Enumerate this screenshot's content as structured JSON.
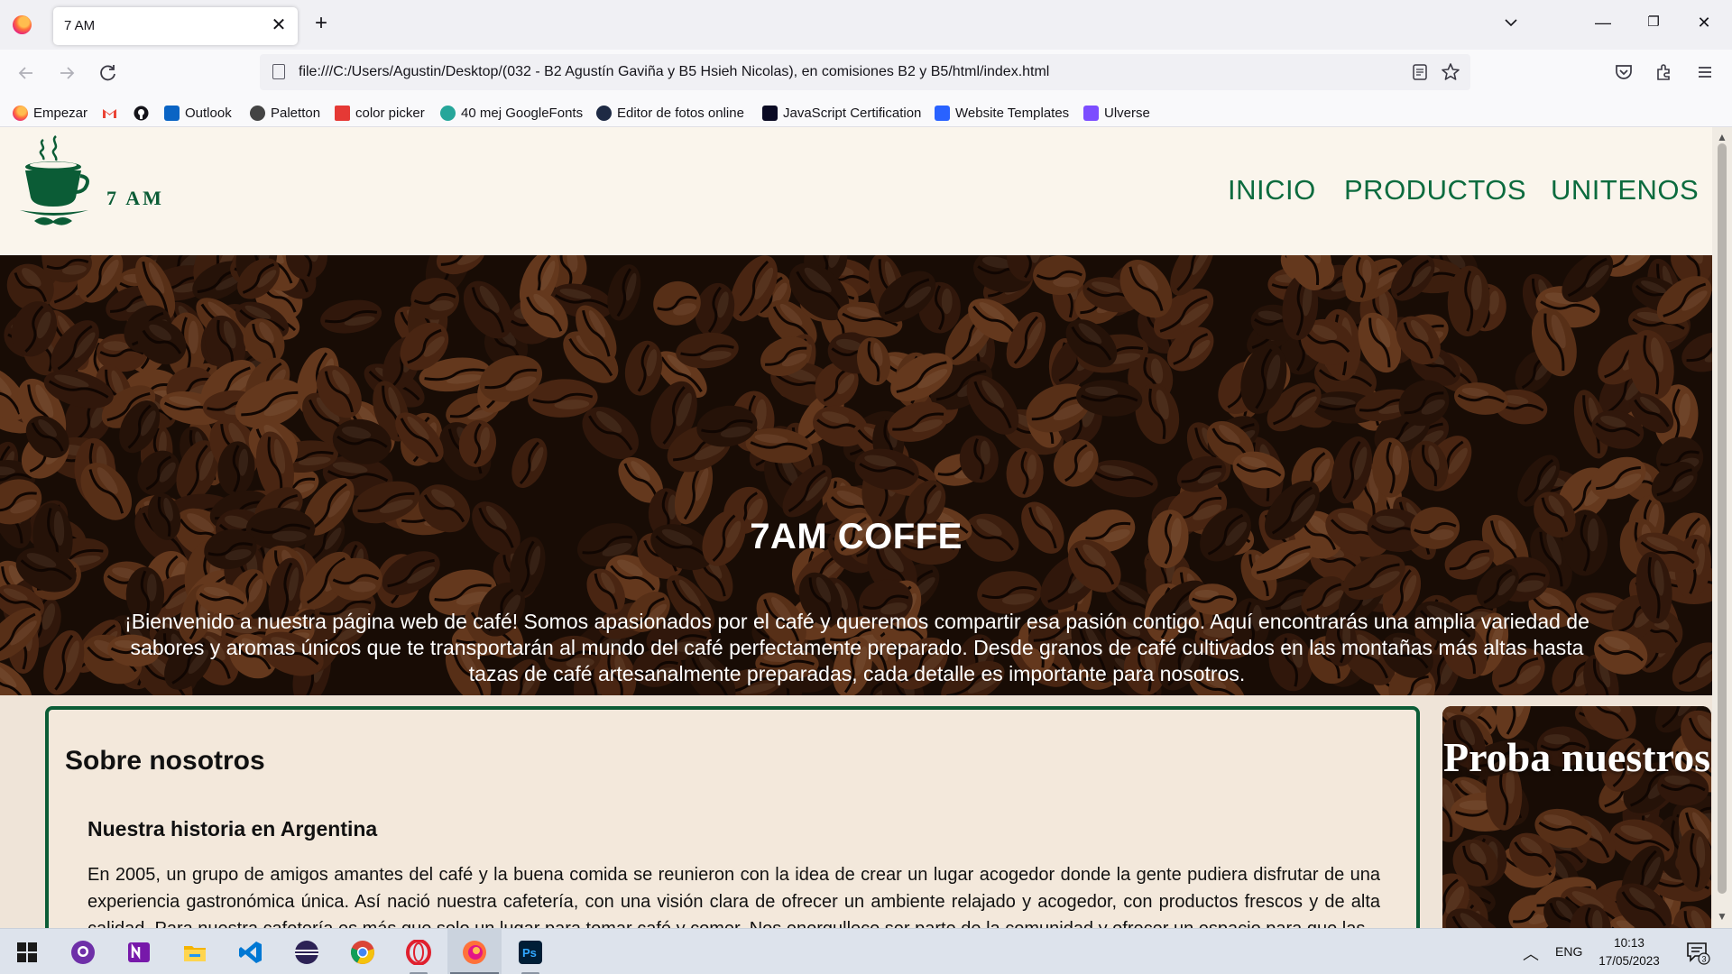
{
  "browser": {
    "tab_title": "7 AM",
    "tab_close_glyph": "✕",
    "new_tab_glyph": "+",
    "url": "file:///C:/Users/Agustin/Desktop/(032 - B2 Agustín Gaviña y B5 Hsieh Nicolas), en comisiones B2 y B5/html/index.html",
    "window_controls": {
      "minimize": "—",
      "restore": "❐",
      "close": "✕"
    },
    "bookmarks": [
      {
        "label": "Empezar",
        "icon": "firefox-icon"
      },
      {
        "label": "",
        "icon": "gmail-icon"
      },
      {
        "label": "",
        "icon": "github-icon"
      },
      {
        "label": "Outlook",
        "icon": "outlook-icon"
      },
      {
        "label": "Paletton",
        "icon": "paletton-icon"
      },
      {
        "label": "color picker",
        "icon": "color-picker-icon"
      },
      {
        "label": "40 mej GoogleFonts",
        "icon": "googlefonts-icon"
      },
      {
        "label": "Editor de fotos online",
        "icon": "photo-editor-icon"
      },
      {
        "label": "JavaScript Certification",
        "icon": "freecodecamp-icon"
      },
      {
        "label": "Website Templates",
        "icon": "templates-icon"
      },
      {
        "label": "Ulverse",
        "icon": "uiverse-icon"
      }
    ]
  },
  "site": {
    "logo_text": "7 AM",
    "nav": [
      "INICIO",
      "PRODUCTOS",
      "UNITENOS"
    ],
    "hero": {
      "title": "7AM COFFE",
      "text": "¡Bienvenido a nuestra página web de café! Somos apasionados por el café y queremos compartir esa pasión contigo. Aquí encontrarás una amplia variedad de sabores y aromas únicos que te transportarán al mundo del café perfectamente preparado. Desde granos de café cultivados en las montañas más altas hasta tazas de café artesanalmente preparadas, cada detalle es importante para nosotros."
    },
    "about": {
      "heading": "Sobre nosotros",
      "subheading": "Nuestra historia en Argentina",
      "paragraph": "En 2005, un grupo de amigos amantes del café y la buena comida se reunieron con la idea de crear un lugar acogedor donde la gente pudiera disfrutar de una experiencia gastronómica única. Así nació nuestra cafetería, con una visión clara de ofrecer un ambiente relajado y acogedor, con productos frescos y de alta calidad. Para nuestra cafetería es más que solo un lugar para tomar café y comer. Nos enorgullece ser parte de la comunidad y ofrecer un espacio para que las"
    },
    "promo": {
      "text": "Proba nuestros"
    }
  },
  "taskbar": {
    "apps": [
      "windows-start-icon",
      "github-desktop-icon",
      "onenote-icon",
      "file-explorer-icon",
      "vscode-icon",
      "eclipse-icon",
      "chrome-icon",
      "opera-icon",
      "firefox-icon",
      "photoshop-icon"
    ],
    "lang": "ENG",
    "time": "10:13",
    "date": "17/05/2023",
    "notifications": "3"
  },
  "colors": {
    "brand_green": "#0b6b3e",
    "header_bg": "#faf5ec",
    "page_bg": "#efe4d8"
  }
}
